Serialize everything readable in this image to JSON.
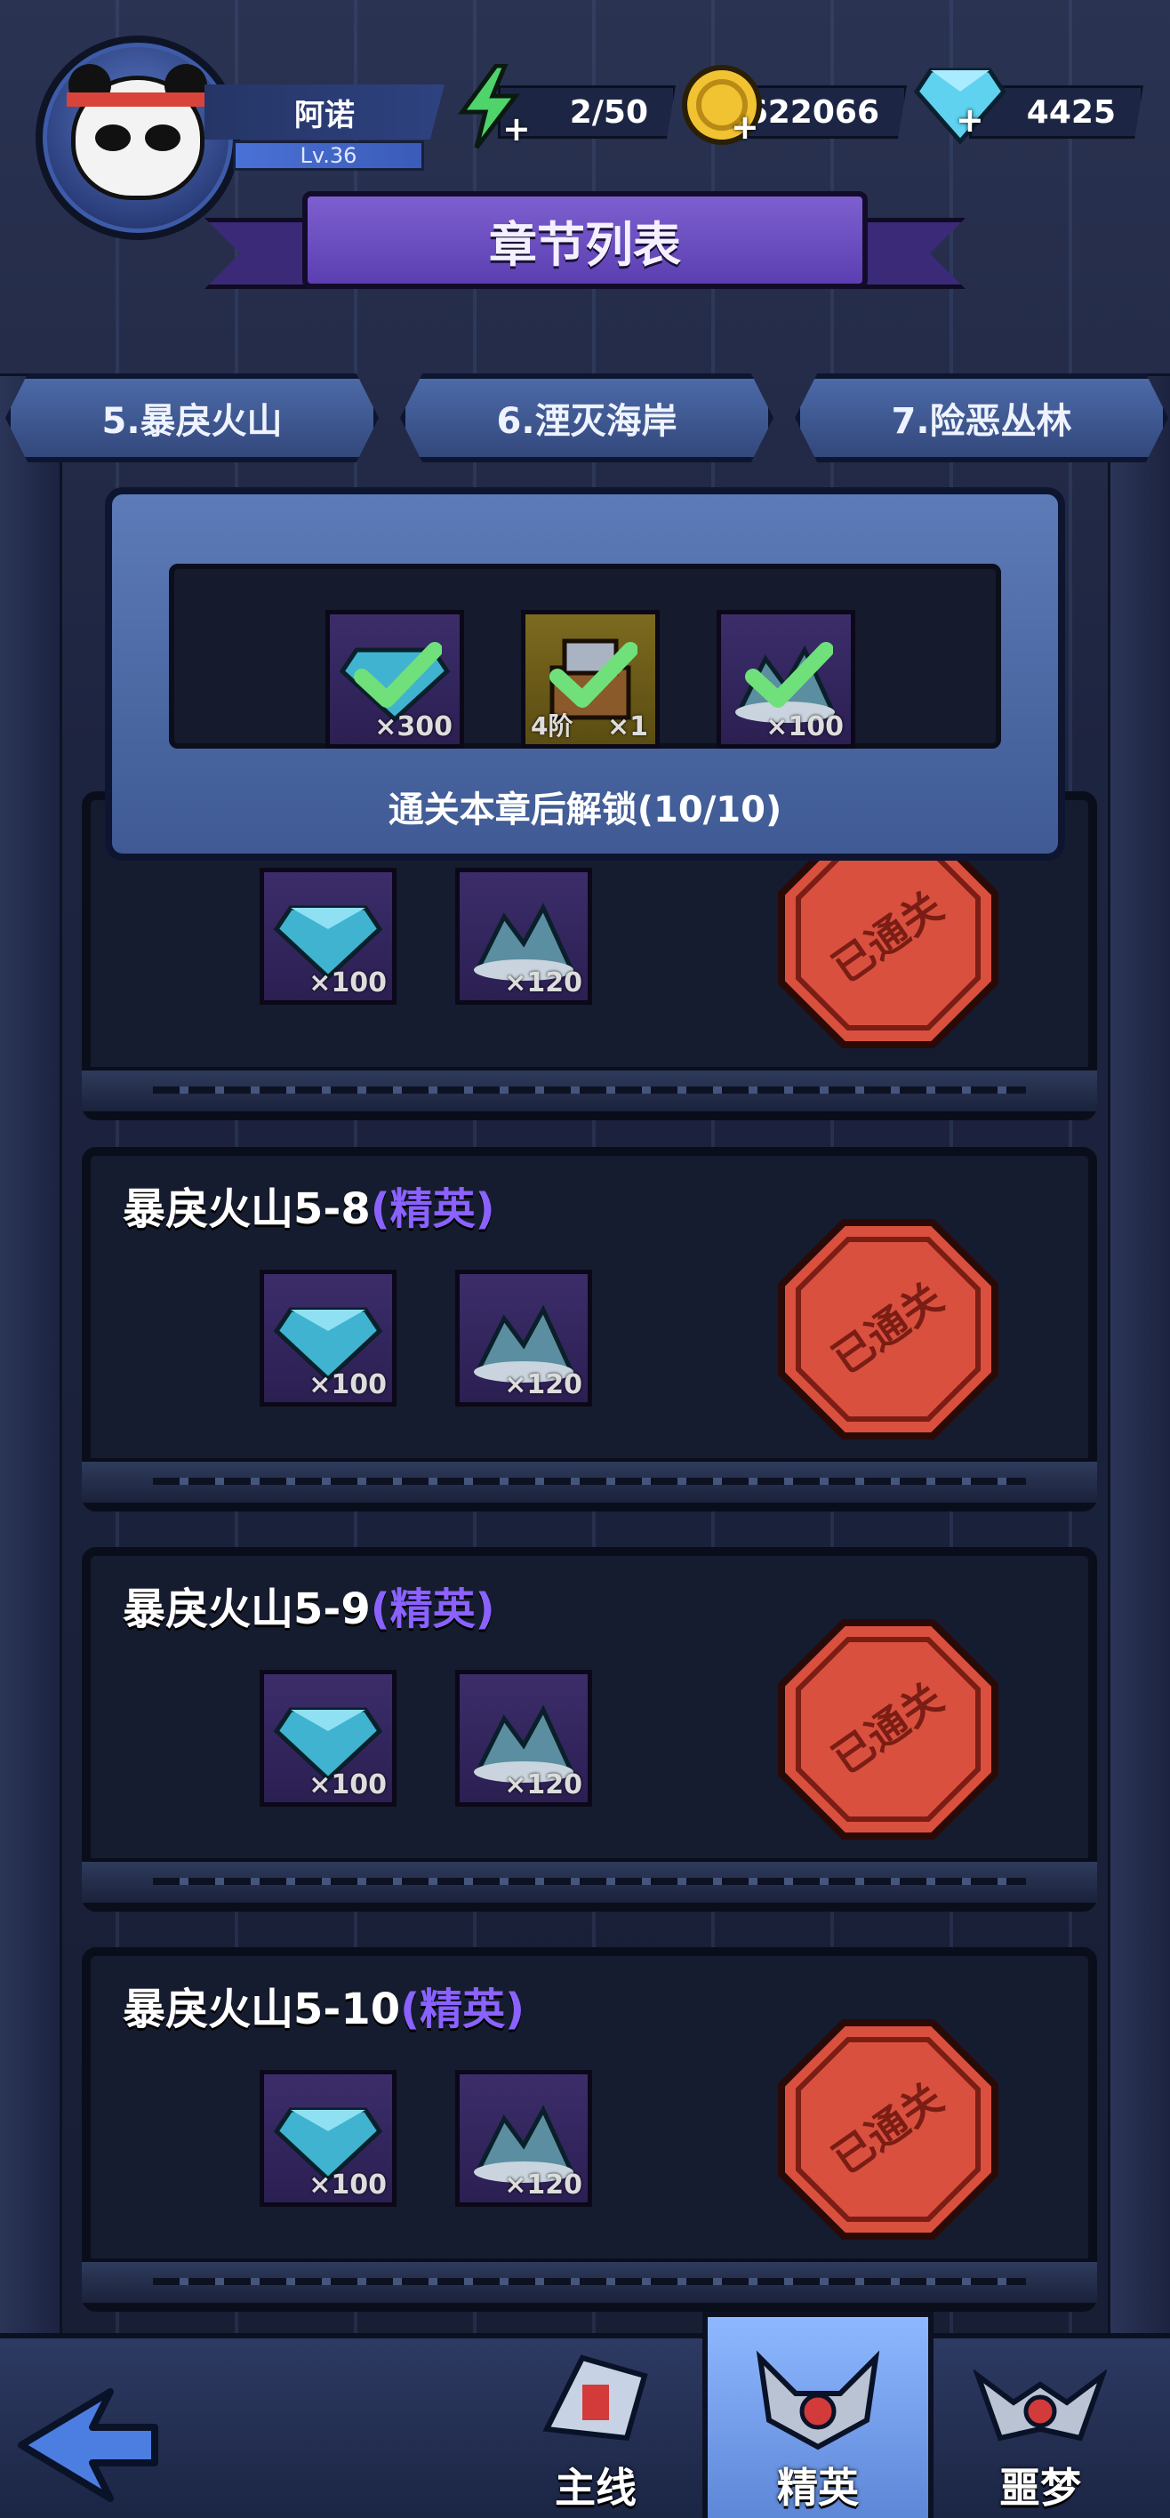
{
  "player": {
    "name": "阿诺",
    "level": "Lv.36"
  },
  "resources": {
    "energy": "2/50",
    "gold": "3622066",
    "diamonds": "4425"
  },
  "title": "章节列表",
  "chapter_tabs": [
    "5.暴戾火山",
    "6.湮灭海岸",
    "7.险恶丛林"
  ],
  "chapter_reward": {
    "items": [
      {
        "icon": "diamond-icon",
        "qty": "×300"
      },
      {
        "icon": "tier-chest-icon",
        "tier": "4阶",
        "qty": "×1"
      },
      {
        "icon": "crystal-pile-icon",
        "qty": "×100"
      }
    ],
    "caption": "通关本章后解锁(10/10)"
  },
  "stages": [
    {
      "title": "",
      "elite": "",
      "rewards": [
        "×100",
        "×120"
      ],
      "status": "已通关"
    },
    {
      "title": "暴戾火山5-8",
      "elite": "(精英)",
      "rewards": [
        "×100",
        "×120"
      ],
      "status": "已通关"
    },
    {
      "title": "暴戾火山5-9",
      "elite": "(精英)",
      "rewards": [
        "×100",
        "×120"
      ],
      "status": "已通关"
    },
    {
      "title": "暴戾火山5-10",
      "elite": "(精英)",
      "rewards": [
        "×100",
        "×120"
      ],
      "status": "已通关"
    }
  ],
  "nav": {
    "main": "主线",
    "elite": "精英",
    "nightmare": "噩梦"
  },
  "colors": {
    "elite_accent": "#8a62ff",
    "stamp_red": "#d9503f",
    "check_green": "#6fe07a"
  }
}
